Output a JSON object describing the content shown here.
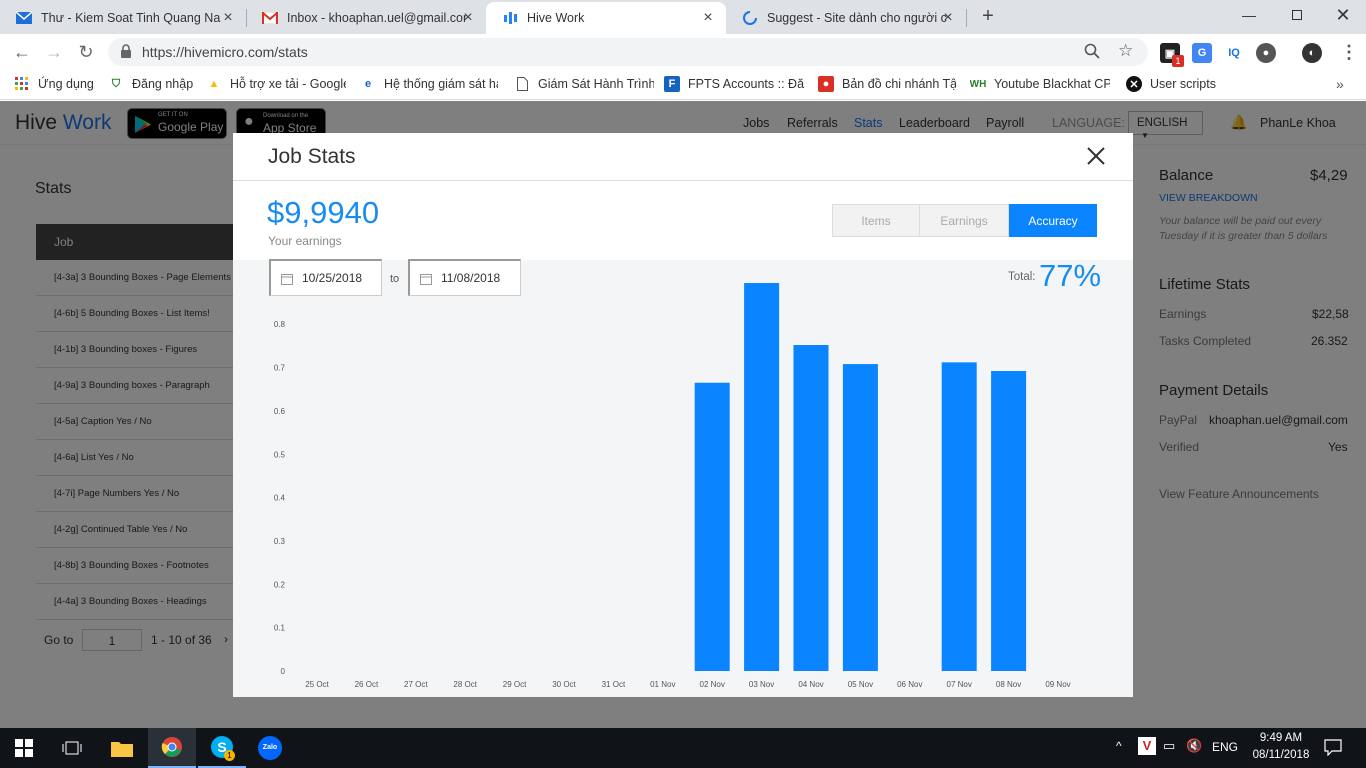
{
  "browser": {
    "tabs": [
      {
        "title": "Thư - Kiem Soat Tinh Quang Nam",
        "icon": "mail-icon"
      },
      {
        "title": "Inbox - khoaphan.uel@gmail.com",
        "icon": "gmail-icon"
      },
      {
        "title": "Hive Work",
        "icon": "hive-icon"
      },
      {
        "title": "Suggest - Site dành cho người chơi",
        "icon": "loading-icon"
      }
    ],
    "url": "https://hivemicro.com/stats",
    "bookmarks": [
      "Ứng dụng",
      "Đăng nhập",
      "Hỗ trợ xe tải - Google",
      "Hệ thống giám sát hà",
      "Giám Sát Hành Trình",
      "FPTS Accounts :: Đăng",
      "Bản đồ chi nhánh Tập",
      "Youtube Blackhat CPA",
      "User scripts"
    ],
    "ext_badge": "1"
  },
  "app": {
    "logo_part1": "Hive",
    "logo_part2": "Work",
    "google_play_small": "GET IT ON",
    "google_play_big": "Google Play",
    "app_store_small": "Download on the",
    "app_store_big": "App Store",
    "nav": [
      "Jobs",
      "Referrals",
      "Stats",
      "Leaderboard",
      "Payroll"
    ],
    "language_label": "LANGUAGE:",
    "language_value": "ENGLISH",
    "user_name": "PhanLe Khoa",
    "accent": "#1a73e8"
  },
  "stats_page": {
    "title": "Stats",
    "table_header": "Job",
    "jobs": [
      "[4-3a] 3 Bounding Boxes - Page Elements",
      "[4-6b] 5 Bounding Boxes - List Items!",
      "[4-1b] 3 Bounding boxes - Figures",
      "[4-9a] 3 Bounding boxes - Paragraph",
      "[4-5a] Caption Yes / No",
      "[4-6a] List Yes / No",
      "[4-7i] Page Numbers Yes / No",
      "[4-2g] Continued Table Yes / No",
      "[4-8b] 3 Bounding Boxes - Footnotes",
      "[4-4a] 3 Bounding Boxes - Headings"
    ],
    "pager_goto": "Go to",
    "pager_page": "1",
    "pager_range": "1 - 10 of 36"
  },
  "sidebar": {
    "balance_label": "Balance",
    "balance_value": "$4,29",
    "view_breakdown": "VIEW BREAKDOWN",
    "balance_note": "Your balance will be paid out every Tuesday if it is greater than 5 dollars",
    "lifetime_title": "Lifetime Stats",
    "earnings_label": "Earnings",
    "earnings_value": "$22,58",
    "tasks_label": "Tasks Completed",
    "tasks_value": "26.352",
    "payment_title": "Payment Details",
    "paypal_label": "PayPal",
    "paypal_value": "khoaphan.uel@gmail.com",
    "verified_label": "Verified",
    "verified_value": "Yes",
    "feature_link": "View Feature Announcements"
  },
  "modal": {
    "title": "Job Stats",
    "amount": "$9,9940",
    "amount_label": "Your earnings",
    "segments": [
      "Items",
      "Earnings",
      "Accuracy"
    ],
    "active_segment": "Accuracy",
    "date_from": "10/25/2018",
    "date_to_label": "to",
    "date_to": "11/08/2018",
    "total_label": "Total:",
    "total_value": "77%"
  },
  "chart_data": {
    "type": "bar",
    "categories": [
      "25 Oct",
      "26 Oct",
      "27 Oct",
      "28 Oct",
      "29 Oct",
      "30 Oct",
      "31 Oct",
      "01 Nov",
      "02 Nov",
      "03 Nov",
      "04 Nov",
      "05 Nov",
      "06 Nov",
      "07 Nov",
      "08 Nov",
      "09 Nov"
    ],
    "values": [
      null,
      null,
      null,
      null,
      null,
      null,
      null,
      null,
      0.665,
      0.895,
      0.752,
      0.708,
      null,
      0.712,
      0.692,
      null
    ],
    "yticks": [
      "0",
      "0.1",
      "0.2",
      "0.3",
      "0.4",
      "0.5",
      "0.6",
      "0.7",
      "0.8"
    ],
    "ylim": [
      0,
      0.9
    ],
    "bar_color": "#0a84ff",
    "grid": false
  },
  "taskbar": {
    "language": "ENG",
    "time": "9:49 AM",
    "date": "08/11/2018",
    "skype_badge": "1"
  }
}
